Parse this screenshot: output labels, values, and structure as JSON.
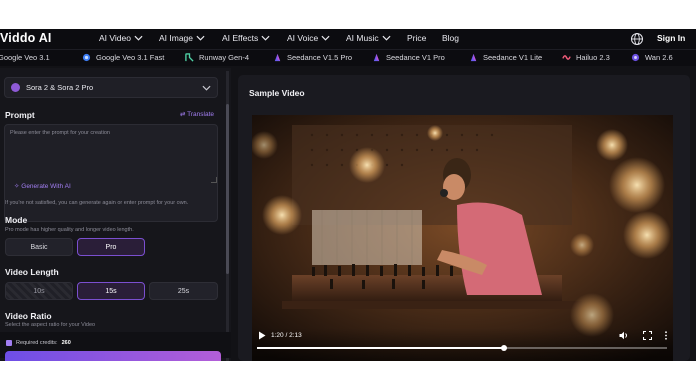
{
  "nav": {
    "logo": "Viddo AI",
    "items": [
      {
        "label": "AI Video",
        "has_menu": true
      },
      {
        "label": "AI Image",
        "has_menu": true
      },
      {
        "label": "AI Effects",
        "has_menu": true
      },
      {
        "label": "AI Voice",
        "has_menu": true
      },
      {
        "label": "AI Music",
        "has_menu": true
      },
      {
        "label": "Price",
        "has_menu": false
      },
      {
        "label": "Blog",
        "has_menu": false
      }
    ],
    "globe_icon": "globe-icon",
    "signin": "Sign In"
  },
  "models": [
    {
      "label": "Google Veo 3.1",
      "icon": "google-veo-icon",
      "color": "#8ab4f8"
    },
    {
      "label": "Google Veo 3.1 Fast",
      "icon": "google-veo-icon",
      "color": "#8ab4f8"
    },
    {
      "label": "Runway Gen-4",
      "icon": "runway-icon",
      "color": "#4fd1a5"
    },
    {
      "label": "Seedance V1.5 Pro",
      "icon": "seedance-icon",
      "color": "#7c6cf0"
    },
    {
      "label": "Seedance V1 Pro",
      "icon": "seedance-icon",
      "color": "#7c6cf0"
    },
    {
      "label": "Seedance V1 Lite",
      "icon": "seedance-icon",
      "color": "#7c6cf0"
    },
    {
      "label": "Hailuo 2.3",
      "icon": "hailuo-icon",
      "color": "#f25b7a"
    },
    {
      "label": "Wan 2.6",
      "icon": "wan-icon",
      "color": "#9b7bf0"
    }
  ],
  "sidebar": {
    "model_select": "Sora 2 & Sora 2 Pro",
    "prompt_label": "Prompt",
    "translate": "Translate",
    "prompt_placeholder": "Please enter the prompt for your creation",
    "generate_ai": "Generate With AI",
    "prompt_hint": "If you're not satisfied, you can generate again or enter prompt for your own.",
    "mode_label": "Mode",
    "mode_hint": "Pro mode has higher quality and longer video length.",
    "modes": [
      "Basic",
      "Pro"
    ],
    "mode_selected": "Pro",
    "length_label": "Video Length",
    "lengths": [
      "10s",
      "15s",
      "25s"
    ],
    "length_selected": "15s",
    "ratio_label": "Video Ratio",
    "ratio_hint": "Select the aspect ratio for your Video",
    "credits_label": "Required credits:",
    "credits_value": "260"
  },
  "main": {
    "title": "Sample Video",
    "player": {
      "time": "1:20 / 2:13",
      "progress": 0.6015,
      "icons": [
        "play-icon",
        "volume-icon",
        "fullscreen-icon",
        "more-options-icon"
      ]
    }
  },
  "colors": {
    "accent": "#a27ef2",
    "active_border": "#7b4fd0",
    "panel": "#16161b"
  }
}
